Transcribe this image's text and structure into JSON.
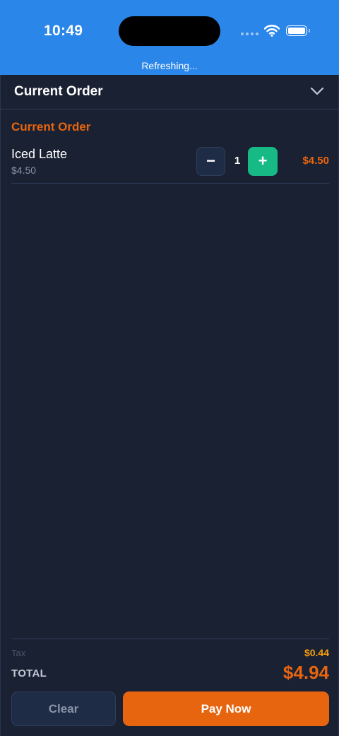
{
  "status_bar": {
    "time": "10:49",
    "refresh_text": "Refreshing..."
  },
  "header": {
    "title": "Current Order",
    "toggle_icon": "chevron-down-icon"
  },
  "order": {
    "section_title": "Current Order",
    "items": [
      {
        "name": "Iced Latte",
        "unit_price": "$4.50",
        "quantity": "1",
        "line_total": "$4.50",
        "decrement_label": "−",
        "increment_label": "+"
      }
    ]
  },
  "summary": {
    "tax_label": "Tax",
    "tax_value": "$0.44",
    "total_label": "TOTAL",
    "total_value": "$4.94"
  },
  "actions": {
    "clear_label": "Clear",
    "pay_label": "Pay Now"
  },
  "colors": {
    "status_bar": "#2a86e8",
    "background": "#1a2133",
    "accent_orange": "#e8650f",
    "increment_green": "#17b985",
    "tax_amber": "#f59e0b"
  }
}
